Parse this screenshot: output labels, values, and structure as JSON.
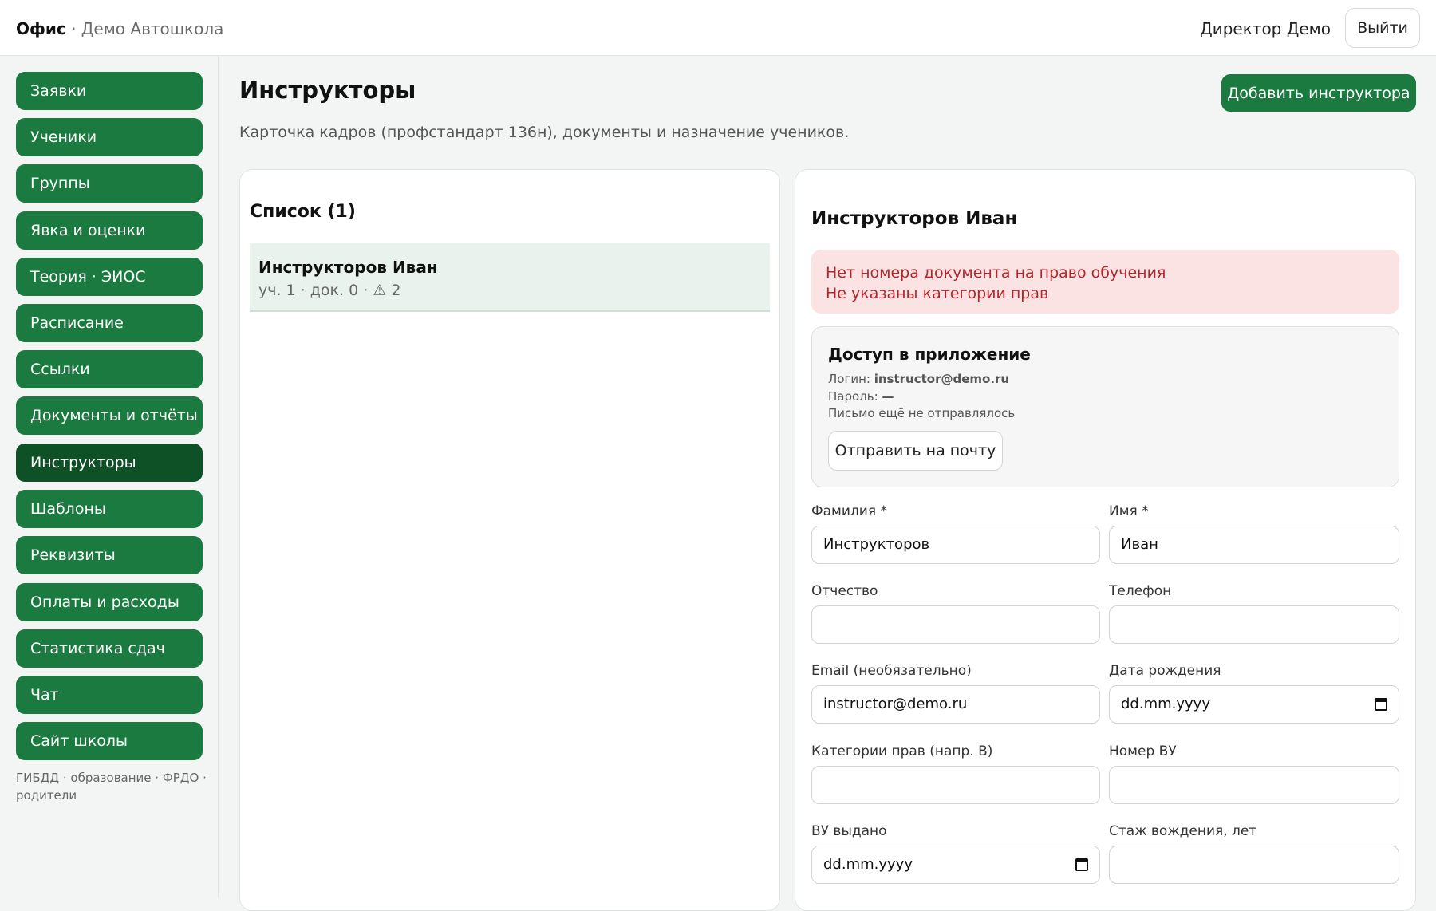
{
  "header": {
    "app_name": "Офис",
    "school_name": "· Демо Автошкола",
    "user_name": "Директор Демо",
    "logout_label": "Выйти"
  },
  "sidebar": {
    "items": [
      {
        "label": "Заявки"
      },
      {
        "label": "Ученики"
      },
      {
        "label": "Группы"
      },
      {
        "label": "Явка и оценки"
      },
      {
        "label": "Теория · ЭИОС"
      },
      {
        "label": "Расписание"
      },
      {
        "label": "Ссылки"
      },
      {
        "label": "Документы и отчёты"
      },
      {
        "label": "Инструкторы",
        "active": true
      },
      {
        "label": "Шаблоны"
      },
      {
        "label": "Реквизиты"
      },
      {
        "label": "Оплаты и расходы"
      },
      {
        "label": "Статистика сдач"
      },
      {
        "label": "Чат"
      },
      {
        "label": "Сайт школы"
      }
    ],
    "footer": "ГИБДД · образование · ФРДО · родители"
  },
  "page": {
    "title": "Инструкторы",
    "subtitle": "Карточка кадров (профстандарт 136н), документы и назначение учеников.",
    "add_button": "Добавить инструктора"
  },
  "list": {
    "title": "Список (1)",
    "rows": [
      {
        "name": "Инструкторов Иван",
        "meta": "уч. 1 · док. 0 · ⚠ 2"
      }
    ]
  },
  "detail": {
    "title": "Инструкторов Иван",
    "alerts": [
      "Нет номера документа на право обучения",
      "Не указаны категории прав"
    ],
    "access": {
      "title": "Доступ в приложение",
      "login_label": "Логин:",
      "login_value": "instructor@demo.ru",
      "password_label": "Пароль:",
      "password_value": "—",
      "mail_status": "Письмо ещё не отправлялось",
      "send_button": "Отправить на почту"
    },
    "fields": {
      "last_name": {
        "label": "Фамилия *",
        "value": "Инструкторов"
      },
      "first_name": {
        "label": "Имя *",
        "value": "Иван"
      },
      "middle_name": {
        "label": "Отчество",
        "value": ""
      },
      "phone": {
        "label": "Телефон",
        "value": ""
      },
      "email": {
        "label": "Email (необязательно)",
        "value": "instructor@demo.ru"
      },
      "birth_date": {
        "label": "Дата рождения",
        "value": "dd.mm.yyyy"
      },
      "categories": {
        "label": "Категории прав (напр. B)",
        "value": ""
      },
      "license_number": {
        "label": "Номер ВУ",
        "value": ""
      },
      "license_issued": {
        "label": "ВУ выдано",
        "value": "dd.mm.yyyy"
      },
      "driving_experience": {
        "label": "Стаж вождения, лет",
        "value": ""
      }
    }
  },
  "colors": {
    "accent": "#1b7a3f",
    "accent_active": "#0f5127",
    "alert_bg": "#fbe3e3",
    "alert_text": "#b3262c",
    "selected_row": "#e9f2ec"
  }
}
